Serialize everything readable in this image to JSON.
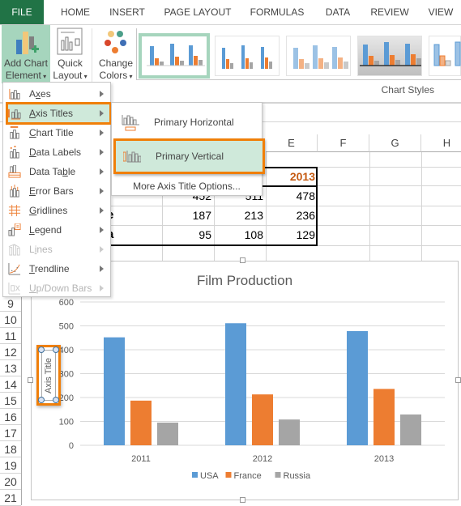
{
  "tabs": [
    "FILE",
    "HOME",
    "INSERT",
    "PAGE LAYOUT",
    "FORMULAS",
    "DATA",
    "REVIEW",
    "VIEW"
  ],
  "ribbon": {
    "add_chart_element": {
      "line1": "Add Chart",
      "line2": "Element"
    },
    "quick_layout": {
      "line1": "Quick",
      "line2": "Layout"
    },
    "change_colors": {
      "line1": "Change",
      "line2": "Colors"
    },
    "group_label": "Chart Styles",
    "gallery_count": 5
  },
  "grid": {
    "columns": [
      "E",
      "F",
      "G",
      "H"
    ],
    "header_year": "2013",
    "rows": [
      {
        "label": "",
        "values": [
          "452",
          "511",
          "478"
        ]
      },
      {
        "label": "e",
        "values": [
          "187",
          "213",
          "236"
        ]
      },
      {
        "label": "a",
        "values": [
          "95",
          "108",
          "129"
        ]
      }
    ],
    "row_numbers": [
      "9",
      "10",
      "11",
      "12",
      "13",
      "14",
      "15",
      "16",
      "17",
      "18",
      "19",
      "20",
      "21"
    ]
  },
  "menu": {
    "items": [
      {
        "label": "Axes",
        "underline": "x",
        "icon": "axes-icon",
        "disabled": false,
        "selected": false
      },
      {
        "label": "Axis Titles",
        "underline": "A",
        "icon": "axis-titles-icon",
        "disabled": false,
        "selected": true
      },
      {
        "label": "Chart Title",
        "underline": "C",
        "icon": "chart-title-icon",
        "disabled": false,
        "selected": false
      },
      {
        "label": "Data Labels",
        "underline": "D",
        "icon": "data-labels-icon",
        "disabled": false,
        "selected": false
      },
      {
        "label": "Data Table",
        "underline": "b",
        "icon": "data-table-icon",
        "disabled": false,
        "selected": false
      },
      {
        "label": "Error Bars",
        "underline": "E",
        "icon": "error-bars-icon",
        "disabled": false,
        "selected": false
      },
      {
        "label": "Gridlines",
        "underline": "G",
        "icon": "gridlines-icon",
        "disabled": false,
        "selected": false
      },
      {
        "label": "Legend",
        "underline": "L",
        "icon": "legend-icon",
        "disabled": false,
        "selected": false
      },
      {
        "label": "Lines",
        "underline": "i",
        "icon": "lines-icon",
        "disabled": true,
        "selected": false
      },
      {
        "label": "Trendline",
        "underline": "T",
        "icon": "trendline-icon",
        "disabled": false,
        "selected": false
      },
      {
        "label": "Up/Down Bars",
        "underline": "U",
        "icon": "up-down-bars-icon",
        "disabled": true,
        "selected": false
      }
    ]
  },
  "submenu": {
    "items": [
      {
        "label": "Primary Horizontal",
        "selected": false
      },
      {
        "label": "Primary Vertical",
        "selected": true
      }
    ],
    "more": "More Axis Title Options..."
  },
  "axis_title": "Axis Title",
  "colors": {
    "accent": "#217346",
    "highlight": "#f07f09",
    "usa": "#5b9bd5",
    "france": "#ed7d31",
    "russia": "#a5a5a5"
  },
  "chart_data": {
    "type": "bar",
    "title": "Film Production",
    "categories": [
      "2011",
      "2012",
      "2013"
    ],
    "series": [
      {
        "name": "USA",
        "values": [
          452,
          511,
          478
        ]
      },
      {
        "name": "France",
        "values": [
          187,
          213,
          236
        ]
      },
      {
        "name": "Russia",
        "values": [
          95,
          108,
          129
        ]
      }
    ],
    "yticks": [
      0,
      100,
      200,
      300,
      400,
      500,
      600
    ],
    "ylim": [
      0,
      600
    ],
    "xlabel": "",
    "ylabel": "Axis Title",
    "grid": true,
    "legend": "bottom"
  }
}
